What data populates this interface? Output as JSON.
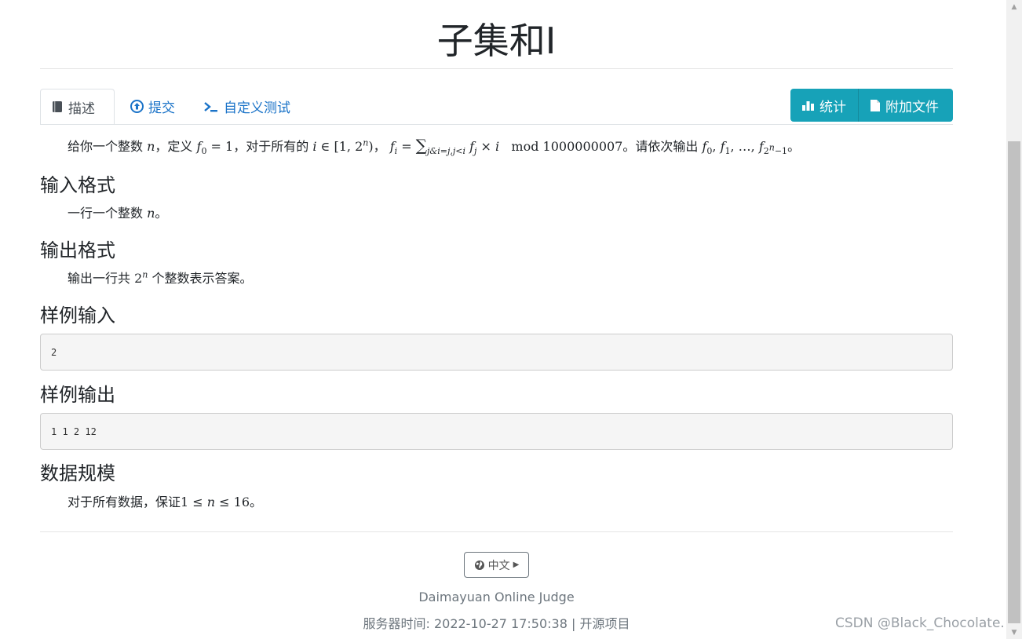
{
  "problem": {
    "title": "子集和I"
  },
  "tabs": [
    {
      "label": "描述",
      "icon": "book-icon"
    },
    {
      "label": "提交",
      "icon": "upload-circle-icon"
    },
    {
      "label": "自定义测试",
      "icon": "terminal-icon"
    }
  ],
  "actions": {
    "stat_label": "统计",
    "files_label": "附加文件"
  },
  "description": {
    "p1": "给你一个整数",
    "p2": "，定义",
    "p3": "，对于所有的",
    "p4": "，",
    "p5": "mod 1000000007",
    "p6": "。请依次输出",
    "p7": "。"
  },
  "sections": {
    "input_format": {
      "heading": "输入格式",
      "text_a": "一行一个整数",
      "text_b": "。"
    },
    "output_format": {
      "heading": "输出格式",
      "text_a": "输出一行共",
      "text_b": "个整数表示答案。"
    },
    "sample_input": {
      "heading": "样例输入",
      "value": "2"
    },
    "sample_output": {
      "heading": "样例输出",
      "value": "1 1 2 12"
    },
    "data_range": {
      "heading": "数据规模",
      "text_a": "对于所有数据，保证",
      "text_b": "。"
    }
  },
  "footer": {
    "language": "中文",
    "site": "Daimayuan Online Judge",
    "server_time_label": "服务器时间: 2022-10-27 17:50:38",
    "separator": "|",
    "open_source": "开源项目"
  },
  "watermark": "CSDN @Black_Chocolate."
}
